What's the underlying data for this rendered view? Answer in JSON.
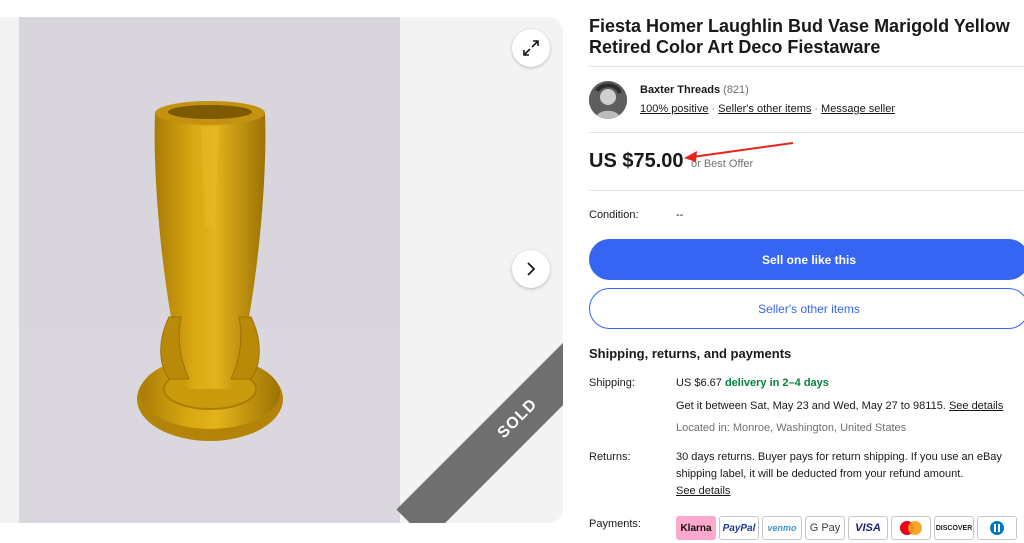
{
  "gallery": {
    "sold_label": "SOLD"
  },
  "listing": {
    "title": "Fiesta Homer Laughlin Bud Vase Marigold Yellow Retired Color Art Deco Fiestaware"
  },
  "seller": {
    "name": "Baxter Threads",
    "feedback_count": "(821)",
    "positive": "100% positive",
    "other_items": "Seller's other items",
    "message": "Message seller"
  },
  "price": {
    "amount": "US $75.00",
    "offer": "or Best Offer"
  },
  "condition": {
    "label": "Condition:",
    "value": "--"
  },
  "buttons": {
    "sell": "Sell one like this",
    "other_items": "Seller's other items"
  },
  "shipping": {
    "heading": "Shipping, returns, and payments",
    "label": "Shipping:",
    "cost": "US $6.67",
    "delivery": "delivery in 2–4 days",
    "between": "Get it between Sat, May 23 and Wed, May 27 to 98115.",
    "see_details": "See details",
    "location": "Located in: Monroe, Washington, United States"
  },
  "returns": {
    "label": "Returns:",
    "line1": "30 days returns. Buyer pays for return shipping. If you use an eBay",
    "line2": "shipping label, it will be deducted from your refund amount.",
    "see_details": "See details"
  },
  "payments": {
    "label": "Payments:",
    "methods": [
      "Klarna",
      "PayPal",
      "venmo",
      "G Pay",
      "VISA",
      "Mastercard",
      "DISCOVER",
      "Diners Club"
    ]
  },
  "colors": {
    "accent": "#3665f3",
    "green": "#05823f",
    "vase": "#c99a0c",
    "arrow": "#e8231b"
  }
}
